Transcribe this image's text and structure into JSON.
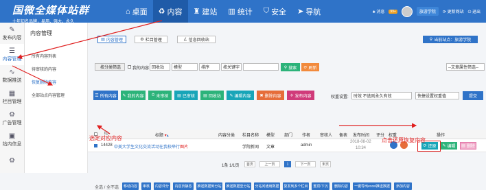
{
  "top": {
    "logo_title": "国微全媒体站群",
    "logo_sub": "十年知名品牌，易用、强大、永久",
    "nav": [
      {
        "icon": "⌂",
        "label": "桌面"
      },
      {
        "icon": "♻",
        "label": "内容"
      },
      {
        "icon": "♜",
        "label": "建站"
      },
      {
        "icon": "▥",
        "label": "统计"
      },
      {
        "icon": "⛉",
        "label": "安全"
      },
      {
        "icon": "➤",
        "label": "导航"
      }
    ],
    "msg_label": "♣ 消息",
    "msg_count": "99+",
    "user": "旅游学院",
    "update": "⟳ 更新网站",
    "logout": "⏻ 退出"
  },
  "sidebar": [
    {
      "icon": "✎",
      "label": "发布内容"
    },
    {
      "icon": "☰",
      "label": "内容管理"
    },
    {
      "icon": "∿",
      "label": "数据推送"
    },
    {
      "icon": "▦",
      "label": "栏目管理"
    },
    {
      "icon": "⚙",
      "label": "广告管理"
    },
    {
      "icon": "▣",
      "label": "站内信息"
    },
    {
      "icon": "⚙",
      "label": ""
    }
  ],
  "submenu": {
    "title": "内容管理",
    "items": [
      "所有内容列表",
      "待审核的内容",
      "恢复删除内容",
      "全部站点内容管理"
    ]
  },
  "toolbar": {
    "content_mgmt": "内容管理",
    "column_mgmt": "栏目管理",
    "recycle": "信息回收站",
    "site": "当前站点：旅游学院"
  },
  "filter": {
    "bulk": "按分类筛选",
    "my_content": "我的内容",
    "recycle_sel": "回收站",
    "model_sel": "模型",
    "order_sel": "排序",
    "title_sel": "按关键字",
    "search": "搜索",
    "refresh": "刷新",
    "attr_sel": "--文章属性筛选--"
  },
  "tabs": [
    {
      "icon": "☰",
      "label": "所有内容",
      "color": "#2f73c8"
    },
    {
      "icon": "✎",
      "label": "我的内容",
      "color": "#2cb37a"
    },
    {
      "icon": "⏱",
      "label": "未审核",
      "color": "#2cb37a"
    },
    {
      "icon": "▤",
      "label": "已审核",
      "color": "#18a5b8"
    },
    {
      "icon": "▤",
      "label": "回收站",
      "color": "#2cb37a"
    },
    {
      "icon": "✎",
      "label": "编辑内容",
      "color": "#18a5b8"
    },
    {
      "icon": "✖",
      "label": "删除内容",
      "color": "#e66d3a"
    },
    {
      "icon": "✈",
      "label": "发布内容",
      "color": "#d03b7a"
    }
  ],
  "weight": {
    "label": "权重设置:",
    "value": "时效 不选则永久有效",
    "quick": "快捷设置权重值",
    "submit": "提交"
  },
  "table": {
    "headers": [
      "ID",
      "标题",
      "内容分类",
      "栏目名称",
      "模型",
      "部门",
      "作者",
      "审核人",
      "备表",
      "发布时间",
      "评分",
      "权重",
      "操作"
    ],
    "row": {
      "id": "14428",
      "title": "中美大学生文化交流活动在我校举行",
      "title_tag": "图片",
      "column": "学院新闻",
      "model": "文章",
      "author": "admin",
      "date": "2018-08-02",
      "time": "10:34",
      "restore": "还原",
      "edit": "编辑",
      "delete": "删除"
    }
  },
  "pagination": {
    "info": "1条 1/1页",
    "first": "首页",
    "prev": "上一页",
    "page": "1",
    "next": "下一页",
    "last": "末页"
  },
  "bottom": {
    "select_all": "全选 / 全不选",
    "buttons": [
      "移动内容",
      "审核",
      "内容评分",
      "内容页静态",
      "推送数据到分站",
      "推送数据至分站",
      "分站间通用数据",
      "复发到多个栏目",
      "置顶/下沉",
      "删除内容",
      "一键导出excel推送数据",
      "添加内容"
    ]
  },
  "annotations": {
    "select": "选定对应内容",
    "restore": "点击还原恢复内容"
  },
  "colors": {
    "primary": "#2f73c8",
    "annotation": "#e02020"
  }
}
